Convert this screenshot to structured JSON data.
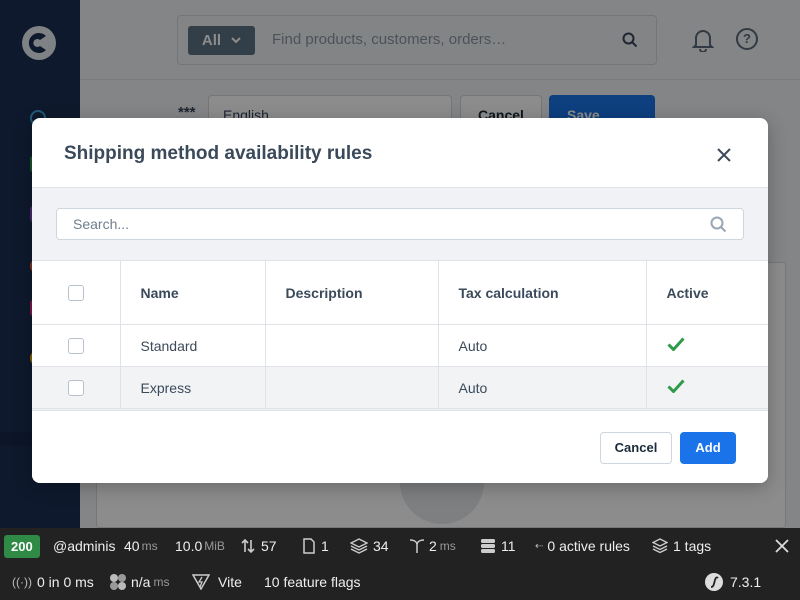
{
  "topbar": {
    "filter_label": "All",
    "search_placeholder": "Find products, customers, orders…",
    "icons": [
      "bell-icon",
      "help-icon"
    ]
  },
  "toolbar": {
    "stars": "***",
    "language": "English",
    "cancel_label": "Cancel",
    "save_label": "Save"
  },
  "modal": {
    "title": "Shipping method availability rules",
    "search_placeholder": "Search...",
    "table": {
      "headers": [
        "Name",
        "Description",
        "Tax calculation",
        "Active"
      ],
      "rows": [
        {
          "name": "Standard",
          "description": "",
          "tax": "Auto",
          "active": true
        },
        {
          "name": "Express",
          "description": "",
          "tax": "Auto",
          "active": true
        }
      ]
    },
    "cancel_label": "Cancel",
    "add_label": "Add",
    "colors": {
      "primary": "#1a73e8",
      "check": "#2e9b4a"
    }
  },
  "debugbar": {
    "status": "200",
    "user": "@administ",
    "time_value": "40",
    "time_unit": "ms",
    "memory_value": "10.0",
    "memory_unit": "MiB",
    "requests": "57",
    "files": "1",
    "layers": "34",
    "flow_value": "2",
    "flow_unit": "ms",
    "db": "11",
    "rules": "0 active rules",
    "tags": "1 tags",
    "events": "0 in 0 ms",
    "cache_value": "n/a",
    "cache_unit": "ms",
    "vite": "Vite",
    "flags": "10 feature flags",
    "version": "7.3.1"
  }
}
